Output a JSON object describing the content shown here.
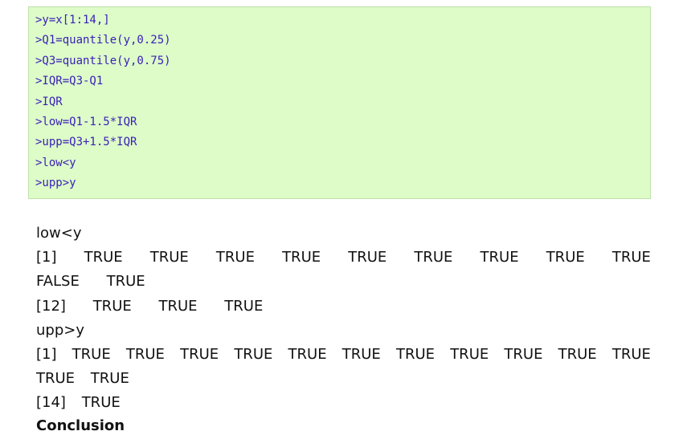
{
  "code_block": {
    "lines": [
      ">y=x[1:14,]",
      ">Q1=quantile(y,0.25)",
      ">Q3=quantile(y,0.75)",
      ">IQR=Q3-Q1",
      ">IQR",
      ">low=Q1-1.5*IQR",
      ">upp=Q3+1.5*IQR",
      ">low<y",
      ">upp>y"
    ]
  },
  "output": {
    "low_header": "low<y",
    "low_row1": [
      "[1]",
      "TRUE",
      "TRUE",
      "TRUE",
      "TRUE",
      "TRUE",
      "TRUE",
      "TRUE",
      "TRUE",
      "TRUE"
    ],
    "low_row2": [
      "FALSE",
      "TRUE"
    ],
    "low_row3": [
      "[12]",
      "TRUE",
      "TRUE",
      "TRUE"
    ],
    "upp_header": "upp>y",
    "upp_row1": [
      "[1]",
      "TRUE",
      "TRUE",
      "TRUE",
      "TRUE",
      "TRUE",
      "TRUE",
      "TRUE",
      "TRUE",
      "TRUE",
      "TRUE",
      "TRUE"
    ],
    "upp_row2": [
      "TRUE",
      "TRUE"
    ],
    "upp_row3": [
      "[14]",
      "TRUE"
    ]
  },
  "truncated_text": "Conclusion"
}
